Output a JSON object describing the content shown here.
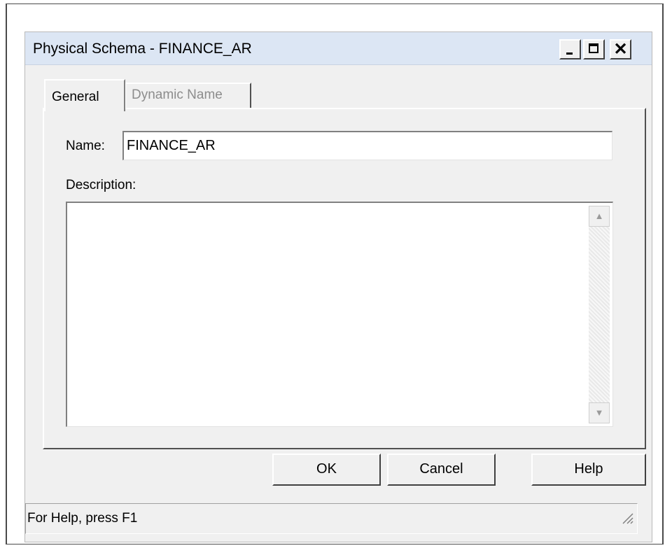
{
  "window": {
    "title": "Physical Schema - FINANCE_AR",
    "controls": {
      "minimize_icon": "minimize-icon",
      "maximize_icon": "maximize-icon",
      "close_label": "✕"
    }
  },
  "tabs": [
    {
      "label": "General",
      "active": true
    },
    {
      "label": "Dynamic Name",
      "active": false
    }
  ],
  "form": {
    "name_label": "Name:",
    "name_value": "FINANCE_AR",
    "description_label": "Description:",
    "description_value": ""
  },
  "buttons": {
    "ok": "OK",
    "cancel": "Cancel",
    "help": "Help"
  },
  "statusbar": {
    "text": "For Help, press F1"
  }
}
